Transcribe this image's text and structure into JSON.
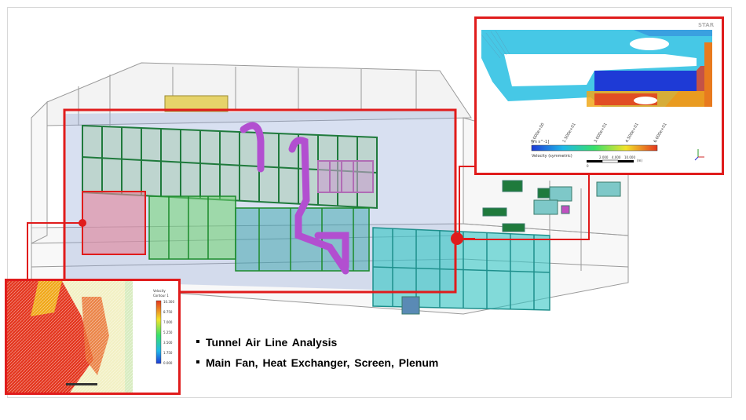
{
  "bullets": [
    "Tunnel  Air Line Analysis",
    "Main Fan,  Heat Exchanger, Screen,  Plenum"
  ],
  "velocity_inset": {
    "logo": "STAR",
    "legend_title": "Velocity (symmetric)",
    "legend_unit": "[m s^-1]",
    "colorbar_ticks": [
      "0.000e+00",
      "1.500e+01",
      "3.000e+01",
      "4.500e+01",
      "6.000e+01"
    ],
    "scale_labels": [
      "0",
      "2.000",
      "4.000",
      "10.000",
      "(m)"
    ]
  },
  "contour_inset": {
    "legend_title": "Velocity",
    "legend_subtitle": "Contour 1",
    "legend_ticks": [
      "10.300",
      "8.750",
      "7.000",
      "5.250",
      "3.500",
      "1.750",
      "0.000"
    ]
  },
  "colors": {
    "highlight_red": "#e01c1c",
    "frame_green": "#1f7a3c",
    "duct_purple": "#b24fd0",
    "plenum_cyan": "#33c7c4",
    "zone_blue": "#8fa6d8"
  }
}
